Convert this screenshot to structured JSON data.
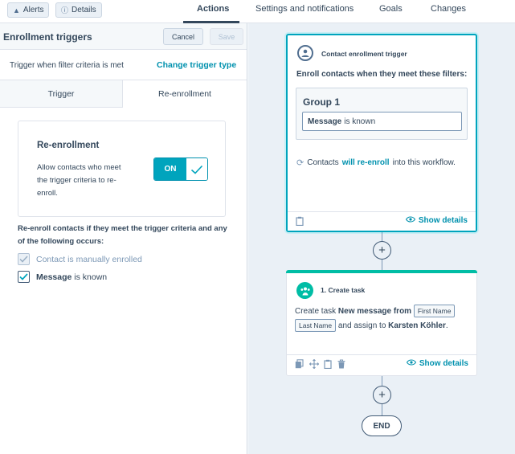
{
  "topbar": {
    "alerts_label": "Alerts",
    "details_label": "Details",
    "tabs": [
      {
        "label": "Actions"
      },
      {
        "label": "Settings and notifications"
      },
      {
        "label": "Goals"
      },
      {
        "label": "Changes"
      }
    ],
    "active_tab": "Actions"
  },
  "left_panel": {
    "title": "Enrollment triggers",
    "cancel_label": "Cancel",
    "save_label": "Save",
    "trigger_text": "Trigger when filter criteria is met",
    "change_trigger_label": "Change trigger type",
    "subtabs": [
      {
        "label": "Trigger"
      },
      {
        "label": "Re-enrollment"
      }
    ],
    "active_subtab": "Re-enrollment",
    "reenroll_card": {
      "title": "Re-enrollment",
      "description": "Allow contacts who meet the trigger criteria to re-enroll.",
      "toggle_label": "ON",
      "toggle_state": true
    },
    "reenroll_condition_text": "Re-enroll contacts if they meet the trigger criteria and any of the following occurs:",
    "options": [
      {
        "label": "Contact is manually enrolled",
        "checked": true,
        "disabled": true
      },
      {
        "property": "Message",
        "suffix": "is known",
        "checked": true,
        "disabled": false
      }
    ]
  },
  "canvas": {
    "trigger_node": {
      "title": "Contact enrollment trigger",
      "subtitle": "Enroll contacts when they meet these filters:",
      "group_title": "Group 1",
      "filter_property": "Message",
      "filter_condition": "is known",
      "reenroll_prefix": "Contacts",
      "reenroll_highlight": "will re-enroll",
      "reenroll_suffix": "into this workflow.",
      "show_details_label": "Show details"
    },
    "action_node": {
      "title": "1. Create task",
      "body_prefix": "Create task",
      "task_name": "New message from",
      "token1": "First Name",
      "token2": "Last Name",
      "assign_text": "and assign to",
      "assignee": "Karsten Köhler",
      "period": ".",
      "show_details_label": "Show details",
      "accent_color": "#00bda5"
    },
    "end_label": "END"
  },
  "colors": {
    "accent": "#00a4bd",
    "link": "#0091ae",
    "text": "#33475b"
  }
}
